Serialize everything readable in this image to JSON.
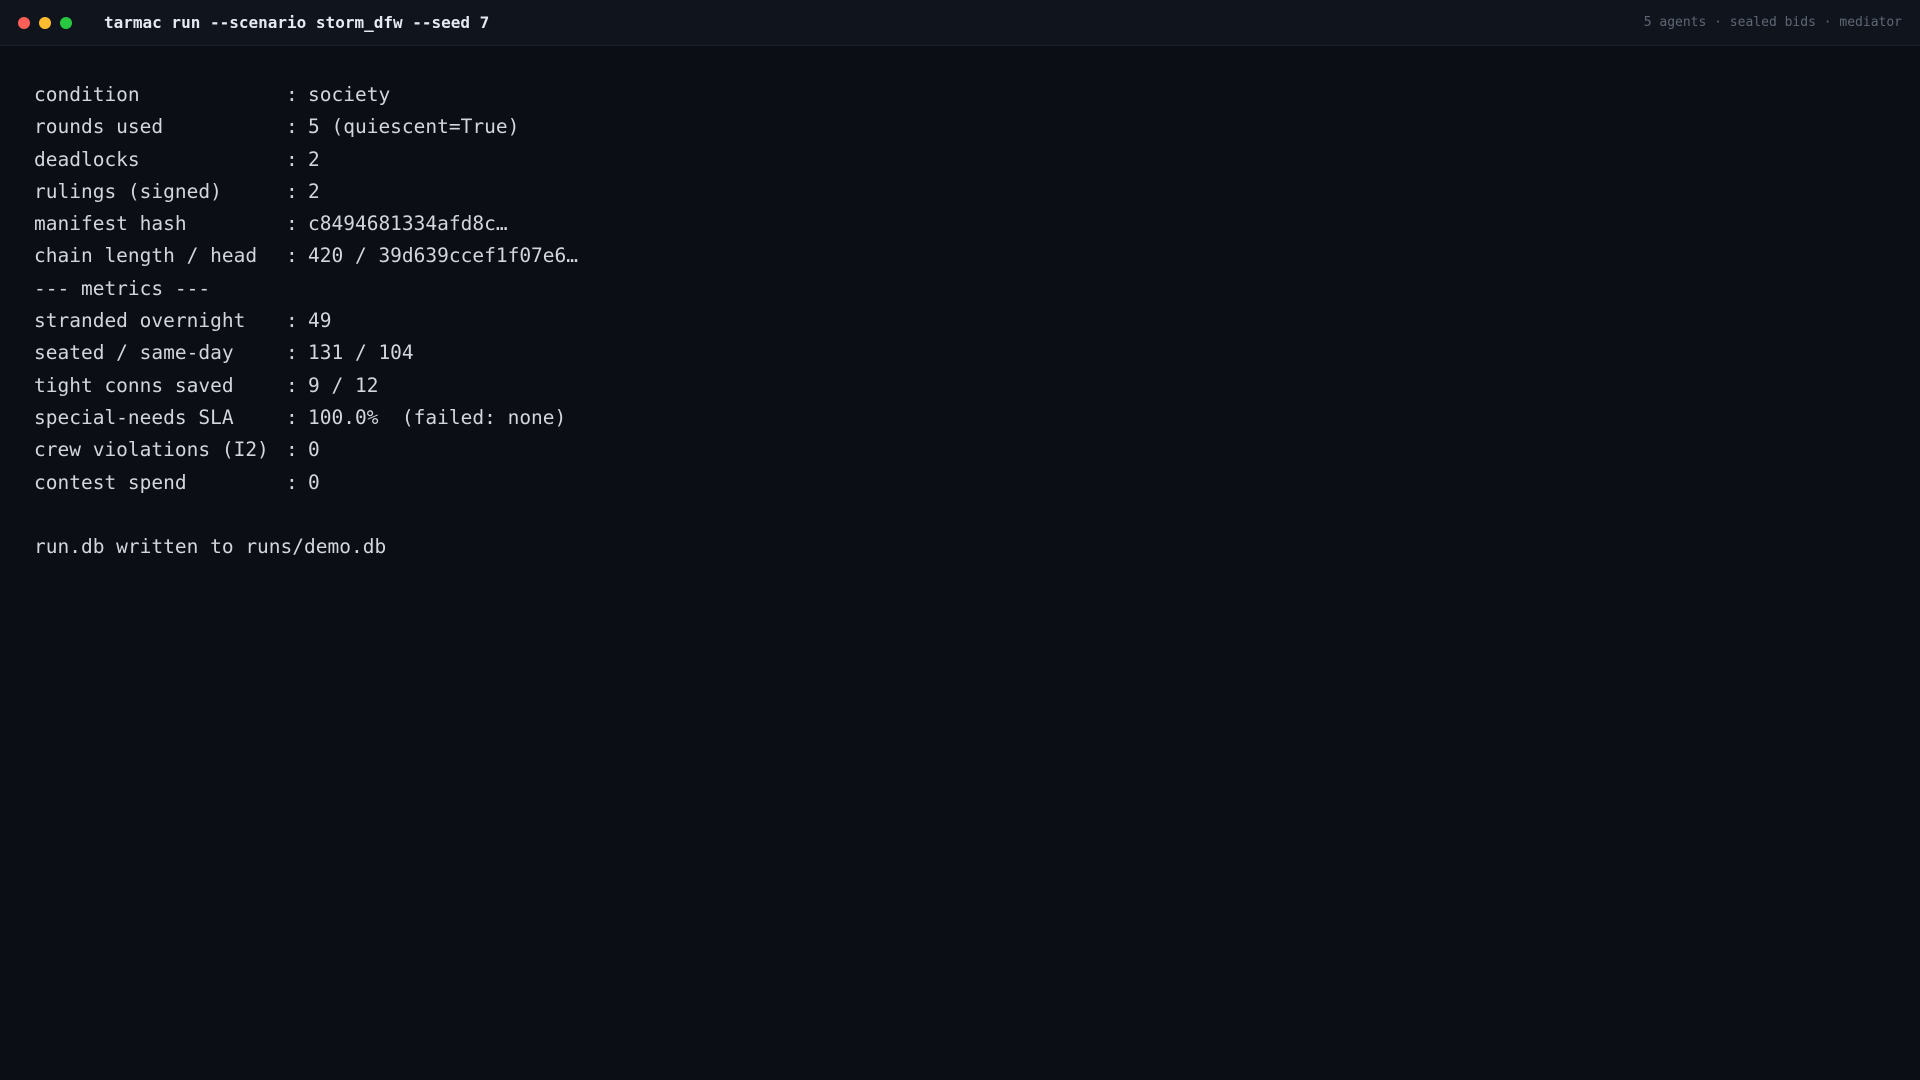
{
  "window": {
    "title": "tarmac run --scenario storm_dfw --seed 7",
    "meta": "5 agents · sealed bids · mediator",
    "lights": {
      "close_color": "#ff5f57",
      "minimize_color": "#febc2e",
      "maximize_color": "#28c840"
    }
  },
  "output": {
    "separator": ":",
    "summary": [
      {
        "key": "condition",
        "value": "society"
      },
      {
        "key": "rounds used",
        "value": "5 (quiescent=True)"
      },
      {
        "key": "deadlocks",
        "value": "2"
      },
      {
        "key": "rulings (signed)",
        "value": "2"
      },
      {
        "key": "manifest hash",
        "value": "c8494681334afd8c…"
      },
      {
        "key": "chain length / head",
        "value": "420 / 39d639ccef1f07e6…"
      }
    ],
    "metrics_header": "--- metrics ---",
    "metrics": [
      {
        "key": "stranded overnight",
        "value": "49"
      },
      {
        "key": "seated / same-day",
        "value": "131 / 104"
      },
      {
        "key": "tight conns saved",
        "value": "9 / 12"
      },
      {
        "key": "special-needs SLA",
        "value": "100.0%  (failed: none)"
      },
      {
        "key": "crew violations (I2)",
        "value": "0"
      },
      {
        "key": "contest spend",
        "value": "0"
      }
    ],
    "footer": "run.db written to runs/demo.db"
  }
}
